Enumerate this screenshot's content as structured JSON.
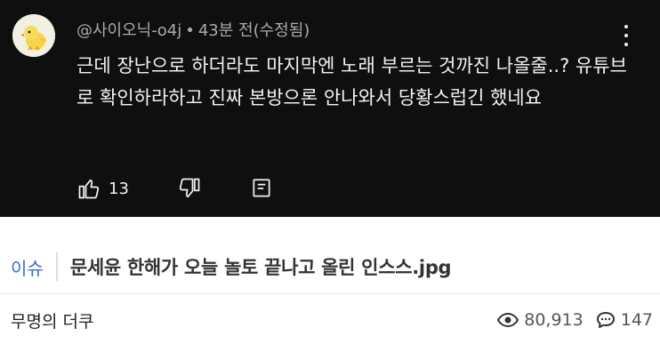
{
  "comment": {
    "author": "@사이오닉-o4j",
    "separator": "•",
    "timestamp": "43분 전(수정됨)",
    "text": "근데 장난으로 하더라도 마지막엔 노래 부르는 것까진 나올줄..? 유튜브로 확인하라하고 진짜 본방으론 안나와서 당황스럽긴 했네요",
    "like_count": "13"
  },
  "post": {
    "category": "이슈",
    "title": "문세윤 한해가 오늘 놀토 끝나고 올린 인스스.jpg",
    "writer": "무명의 더쿠",
    "views": "80,913",
    "comments": "147"
  },
  "colors": {
    "comment_bg": "#0f0f0f",
    "category_accent": "#3b6fd1"
  }
}
